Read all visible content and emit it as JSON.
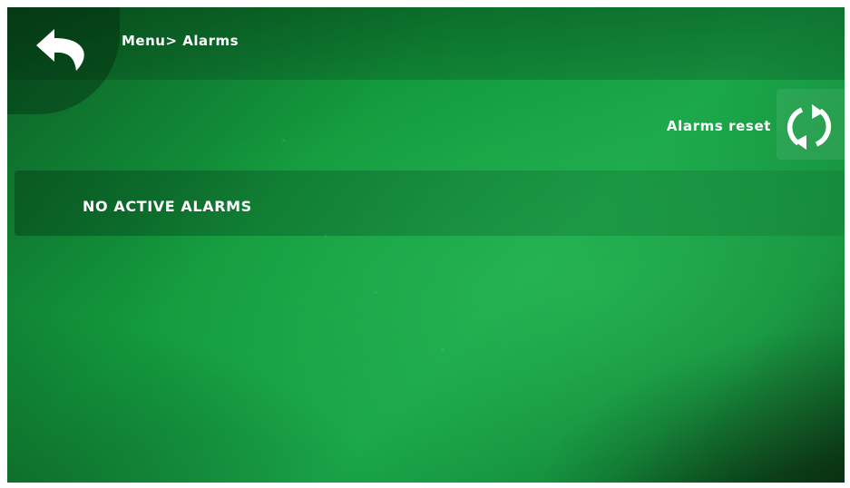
{
  "header": {
    "breadcrumb": "Menu> Alarms",
    "back_icon": "back-arrow-icon"
  },
  "toolbar": {
    "reset_label": "Alarms reset",
    "reset_icon": "refresh-icon"
  },
  "alarms": {
    "status_text": "NO ACTIVE ALARMS"
  },
  "colors": {
    "background_accent": "#1aa64a",
    "background_dark": "#0b4a1c",
    "text": "#ffffff"
  }
}
